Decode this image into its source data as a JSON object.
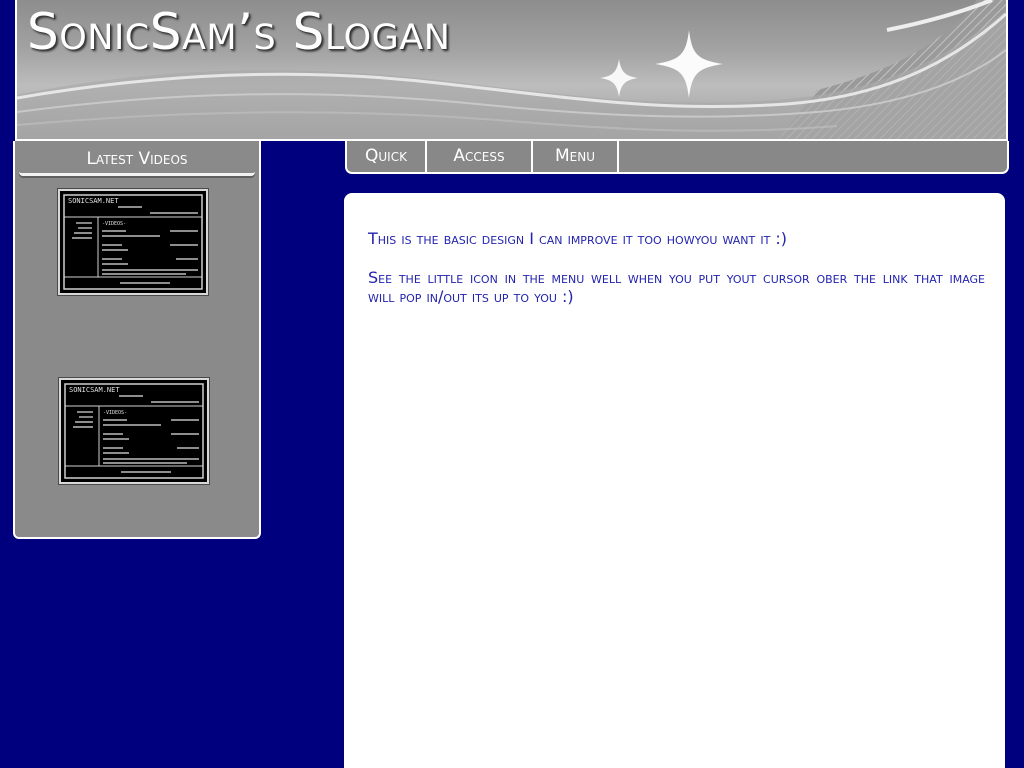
{
  "header": {
    "title": "SonicSam’s Slogan"
  },
  "sidebar": {
    "heading": "Latest Videos",
    "videos": [
      {
        "site": "SONICSAM.NET",
        "section": "-VIDEOS-"
      },
      {
        "site": "SONICSAM.NET",
        "section": "-VIDEOS-"
      }
    ]
  },
  "nav": {
    "items": [
      {
        "label": "Quick"
      },
      {
        "label": "Access"
      },
      {
        "label": "Menu"
      }
    ]
  },
  "content": {
    "paragraphs": [
      "This is the basic design I can improve it too howyou want it :)",
      "See the little icon in the menu well when you put yout cursor ober the link that image will pop in/out its up to you :)"
    ]
  },
  "colors": {
    "background": "#00007f",
    "panel_gray": "#8a8a8a",
    "text_blue": "#2323b0"
  }
}
